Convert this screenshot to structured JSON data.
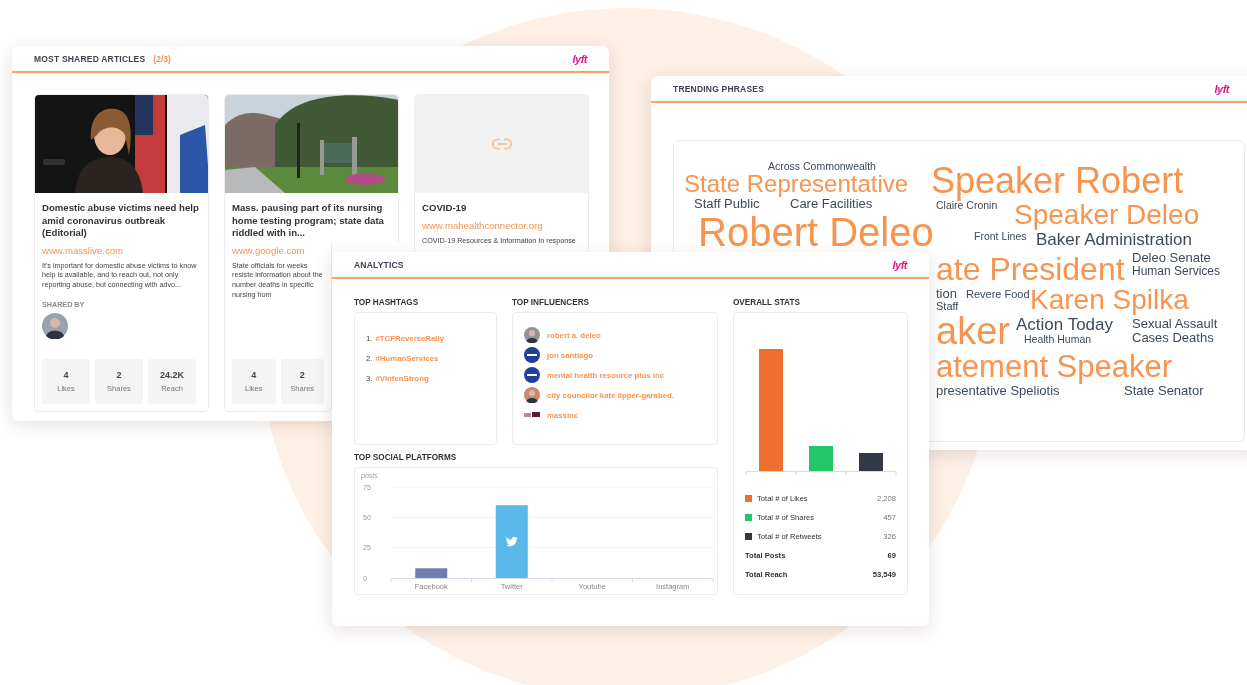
{
  "articles_panel": {
    "title": "MOST SHARED ARTICLES",
    "counter": "(2/3)",
    "logo": "lyft",
    "articles": [
      {
        "image": {
          "kind": "picture"
        },
        "title": "Domestic abuse victims need help amid coronavirus outbreak (Editorial)",
        "url": "www.masslive.com",
        "summary": "It's important for domestic abuse victims to know help is available, and to reach out, not only reporting abuse, but connecting with advo...",
        "shared_by_label": "SHARED BY",
        "stats": [
          {
            "value": "4",
            "label": "Likes"
          },
          {
            "value": "2",
            "label": "Shares"
          },
          {
            "value": "24.2K",
            "label": "Reach"
          }
        ]
      },
      {
        "image": {
          "kind": "picture"
        },
        "title": "Mass. pausing part of its nursing home testing program; state data riddled with in...",
        "url": "www.google.com",
        "summary": "State officials for weeks resiste information about the number deaths in specific nursing hom",
        "stats": [
          {
            "value": "4",
            "label": "Likes"
          },
          {
            "value": "2",
            "label": "Shares"
          }
        ]
      },
      {
        "image": {
          "kind": "link"
        },
        "title": "COVID-19",
        "url": "www.mahealthconnector.org",
        "summary": "COVID-19 Resources & Information In response"
      }
    ]
  },
  "trending_panel": {
    "title": "TRENDING PHRASES",
    "logo": "lyft",
    "words": [
      {
        "text": "Across Commonwealth",
        "color": "#3d4a5c"
      },
      {
        "text": "State Representative",
        "color": "#f7944f"
      },
      {
        "text": "Speaker Robert",
        "color": "#f7944f"
      },
      {
        "text": "Staff Public",
        "color": "#3d4a5c"
      },
      {
        "text": "Care Facilities",
        "color": "#3d4a5c"
      },
      {
        "text": "Claire Cronin",
        "color": "#3d4a5c"
      },
      {
        "text": "Speaker Deleo",
        "color": "#f7944f"
      },
      {
        "text": "Robert Deleo",
        "color": "#f7944f"
      },
      {
        "text": "Front Lines",
        "color": "#3d4a5c"
      },
      {
        "text": "Baker Administration",
        "color": "#3d4a5c"
      },
      {
        "text": "ate President",
        "color": "#f7944f"
      },
      {
        "text": "Deleo Senate",
        "color": "#3d4a5c"
      },
      {
        "text": "Human Services",
        "color": "#3d4a5c"
      },
      {
        "text": "tion",
        "color": "#3d4a5c"
      },
      {
        "text": "Revere Food",
        "color": "#3d4a5c"
      },
      {
        "text": "Staff",
        "color": "#3d4a5c"
      },
      {
        "text": "Karen Spilka",
        "color": "#f7944f"
      },
      {
        "text": "aker",
        "color": "#f7944f"
      },
      {
        "text": "Action Today",
        "color": "#3d4a5c"
      },
      {
        "text": "Sexual Assault",
        "color": "#3d4a5c"
      },
      {
        "text": "Health Human",
        "color": "#3d4a5c"
      },
      {
        "text": "Cases Deaths",
        "color": "#3d4a5c"
      },
      {
        "text": "atement Speaker",
        "color": "#f7944f"
      },
      {
        "text": "presentative Speliotis",
        "color": "#3d4a5c"
      },
      {
        "text": "State Senator",
        "color": "#3d4a5c"
      }
    ]
  },
  "analytics_panel": {
    "title": "ANALYTICS",
    "logo": "lyft",
    "hashtags": {
      "title": "TOP HASHTAGS",
      "items": [
        {
          "number": "1.",
          "tag": "#TCFReverseRally"
        },
        {
          "number": "2.",
          "tag": "#HumanServices"
        },
        {
          "number": "3.",
          "tag": "#VinfenStrong"
        }
      ]
    },
    "influencers": {
      "title": "TOP INFLUENCERS",
      "items": [
        {
          "name": "robert a. deleo"
        },
        {
          "kind": "badge",
          "name": "jon santiago"
        },
        {
          "kind": "badge",
          "name": "mental health resource plus inc"
        },
        {
          "name": "city councilor kate lipper-garabed."
        },
        {
          "kind": "logo",
          "name": "massinc"
        }
      ]
    },
    "social_platforms": {
      "title": "TOP SOCIAL PLATFORMS",
      "chart_data": {
        "type": "bar",
        "ylabel": "posts",
        "categories": [
          "Facebook",
          "Twitter",
          "Youtube",
          "Instagram"
        ],
        "values": [
          8,
          60,
          0,
          0
        ],
        "colors": [
          "#6b7fae",
          "#5bb8ea",
          null,
          null
        ],
        "ylim": [
          0,
          75
        ],
        "yticks": [
          0,
          25,
          50,
          75
        ]
      }
    },
    "overall_stats": {
      "title": "OVERALL STATS",
      "rows": [
        {
          "kind": "legend",
          "label": "Total # of Likes",
          "value": "2,208",
          "color": "#ef6f2e"
        },
        {
          "kind": "legend",
          "label": "Total # of Shares",
          "value": "457",
          "color": "#22c76a"
        },
        {
          "kind": "legend",
          "label": "Total # of Retweets",
          "value": "326",
          "color": "#313946"
        },
        {
          "kind": "total",
          "label": "Total Posts",
          "value": "69"
        },
        {
          "kind": "total",
          "label": "Total Reach",
          "value": "53,549"
        }
      ]
    }
  }
}
